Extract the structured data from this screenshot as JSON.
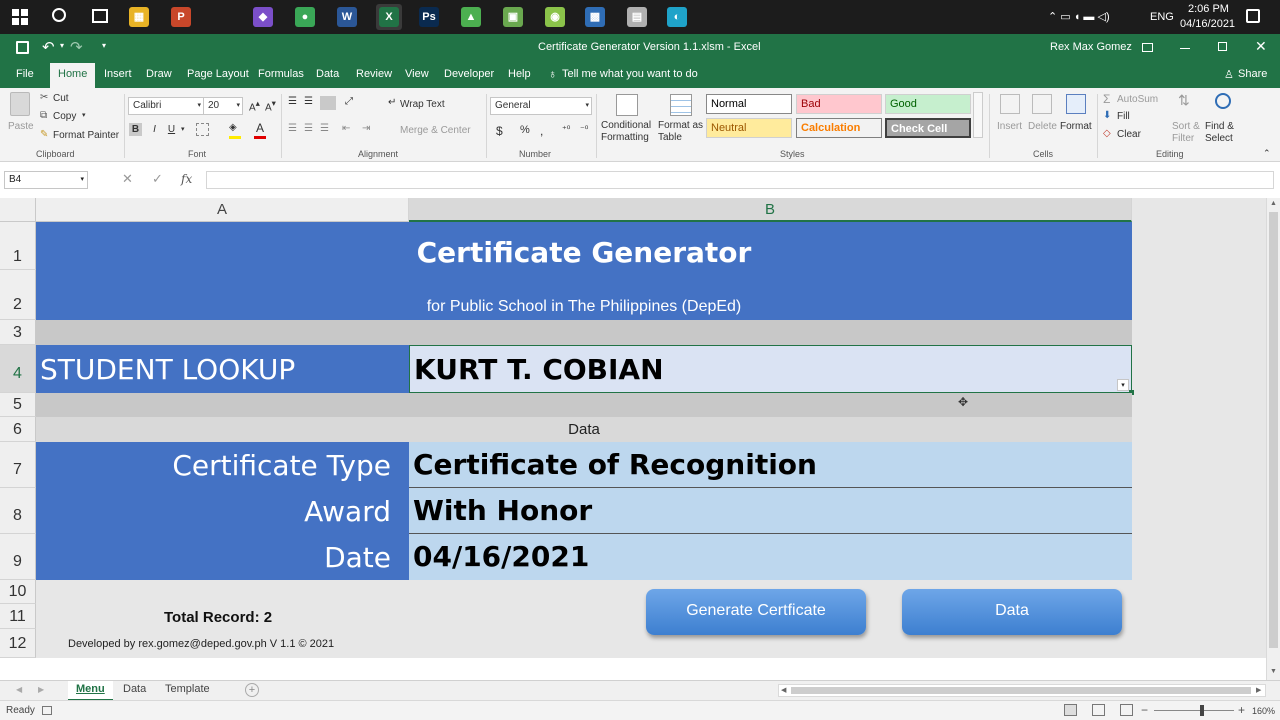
{
  "taskbar": {
    "apps": [
      {
        "name": "file-explorer",
        "glyph": "▦",
        "color": "#e8b325"
      },
      {
        "name": "powerpoint",
        "glyph": "P",
        "color": "#c8472a"
      },
      {
        "name": "visual-studio",
        "glyph": "◆",
        "color": "#7b4fc9"
      },
      {
        "name": "chrome",
        "glyph": "●",
        "color": "#3aa757"
      },
      {
        "name": "word",
        "glyph": "W",
        "color": "#2b5797"
      },
      {
        "name": "excel",
        "glyph": "X",
        "color": "#217346"
      },
      {
        "name": "photoshop",
        "glyph": "Ps",
        "color": "#0a2a4f"
      },
      {
        "name": "media-app",
        "glyph": "▲",
        "color": "#4caf50"
      },
      {
        "name": "app-green",
        "glyph": "▣",
        "color": "#6aa84f"
      },
      {
        "name": "app-android",
        "glyph": "◉",
        "color": "#8bc34a"
      },
      {
        "name": "photos",
        "glyph": "▩",
        "color": "#2f6db5"
      },
      {
        "name": "app-printer",
        "glyph": "▤",
        "color": "#b0b0b0"
      },
      {
        "name": "edge",
        "glyph": "◐",
        "color": "#1fa3c9"
      }
    ],
    "lang": "ENG",
    "time": "2:06 PM",
    "date": "04/16/2021"
  },
  "window": {
    "title": "Certificate Generator Version 1.1.xlsm  -  Excel",
    "user": "Rex Max Gomez"
  },
  "ribbon_tabs": [
    "File",
    "Home",
    "Insert",
    "Draw",
    "Page Layout",
    "Formulas",
    "Data",
    "Review",
    "View",
    "Developer",
    "Help"
  ],
  "tell_me": "Tell me what you want to do",
  "share": "Share",
  "clipboard": {
    "paste": "Paste",
    "cut": "Cut",
    "copy": "Copy",
    "format_painter": "Format Painter",
    "label": "Clipboard"
  },
  "font": {
    "name": "Calibri",
    "size": "20",
    "label": "Font"
  },
  "alignment": {
    "wrap": "Wrap Text",
    "merge": "Merge & Center",
    "label": "Alignment"
  },
  "number": {
    "format": "General",
    "label": "Number"
  },
  "styles_group": {
    "conditional": "Conditional Formatting",
    "format_as_table": "Format as Table",
    "label": "Styles",
    "items": [
      {
        "text": "Normal",
        "bg": "#ffffff",
        "fg": "#000000"
      },
      {
        "text": "Bad",
        "bg": "#ffc7ce",
        "fg": "#9c0006"
      },
      {
        "text": "Good",
        "bg": "#c6efce",
        "fg": "#006100"
      },
      {
        "text": "Neutral",
        "bg": "#ffeb9c",
        "fg": "#9c5700"
      },
      {
        "text": "Calculation",
        "bg": "#f2f2f2",
        "fg": "#fa7d00"
      },
      {
        "text": "Check Cell",
        "bg": "#a5a5a5",
        "fg": "#ffffff"
      }
    ]
  },
  "cells_group": {
    "insert": "Insert",
    "delete": "Delete",
    "format": "Format",
    "label": "Cells"
  },
  "editing": {
    "autosum": "AutoSum",
    "fill": "Fill",
    "clear": "Clear",
    "sort": "Sort & Filter",
    "find": "Find & Select",
    "label": "Editing"
  },
  "formula_bar": {
    "name_box": "B4",
    "formula": ""
  },
  "columns": [
    "A",
    "B"
  ],
  "rows": [
    "1",
    "2",
    "3",
    "4",
    "5",
    "6",
    "7",
    "8",
    "9",
    "10",
    "11",
    "12"
  ],
  "sheet": {
    "title": "Certificate Generator",
    "subtitle": "for Public School in The Philippines (DepEd)",
    "lookup_label": "STUDENT LOOKUP",
    "lookup_value": "KURT T. COBIAN",
    "data_header": "Data",
    "fields": [
      {
        "label": "Certificate Type",
        "value": "Certificate of Recognition"
      },
      {
        "label": "Award",
        "value": "With Honor"
      },
      {
        "label": "Date",
        "value": "04/16/2021"
      }
    ],
    "total_record": "Total Record: 2",
    "footer": "Developed by rex.gomez@deped.gov.ph V 1.1 © 2021",
    "btn_generate": "Generate Certficate",
    "btn_data": "Data"
  },
  "sheet_tabs": [
    "Menu",
    "Data",
    "Template"
  ],
  "status": {
    "ready": "Ready",
    "zoom": "160%"
  }
}
